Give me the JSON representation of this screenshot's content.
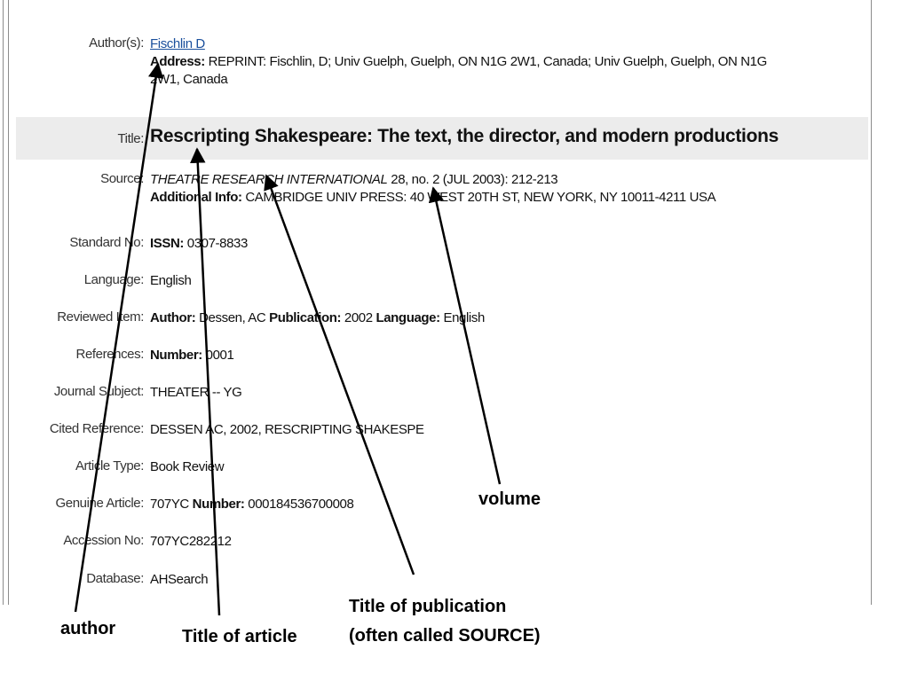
{
  "record": {
    "author": {
      "label": "Author(s):",
      "name": "Fischlin D",
      "address_label": "Address:",
      "address_line1": " REPRINT: Fischlin, D; Univ Guelph, Guelph, ON N1G 2W1, Canada; Univ Guelph, Guelph, ON N1G",
      "address_line2": "2W1, Canada"
    },
    "title": {
      "label": "Title:",
      "value": "Rescripting Shakespeare: The text, the director, and modern productions"
    },
    "source": {
      "label": "Source:",
      "journal": "THEATRE RESEARCH INTERNATIONAL",
      "detail": " 28, no. 2 (JUL 2003): 212-213",
      "additional_label": "Additional Info:",
      "additional_value": " CAMBRIDGE UNIV PRESS: 40 WEST 20TH ST, NEW YORK, NY 10011-4211 USA"
    },
    "standard_no": {
      "label": "Standard No:",
      "key": "ISSN:",
      "value": " 0307-8833"
    },
    "language": {
      "label": "Language:",
      "value": "English"
    },
    "reviewed_item": {
      "label": "Reviewed Item:",
      "author_label": "Author:",
      "author_value": " Dessen, AC ",
      "publication_label": "Publication:",
      "publication_value": " 2002 ",
      "language_label": "Language:",
      "language_value": " English"
    },
    "references": {
      "label": "References:",
      "key": "Number:",
      "value": " 0001"
    },
    "journal_subject": {
      "label": "Journal Subject:",
      "value": "THEATER -- YG"
    },
    "cited_reference": {
      "label": "Cited Reference:",
      "value": "DESSEN AC, 2002, RESCRIPTING SHAKESPE"
    },
    "article_type": {
      "label": "Article Type:",
      "value": "Book Review"
    },
    "genuine_article": {
      "label": "Genuine Article:",
      "pre": "707YC ",
      "key": "Number:",
      "value": " 000184536700008"
    },
    "accession_no": {
      "label": "Accession No:",
      "value": "707YC282212"
    },
    "database": {
      "label": "Database:",
      "value": "AHSearch"
    }
  },
  "callouts": {
    "author": "author",
    "title_of_article": "Title of article",
    "title_of_publication_line1": "Title of publication",
    "title_of_publication_line2": "(often called SOURCE)",
    "volume": "volume"
  },
  "colors": {
    "link": "#1a4f9c",
    "title_band": "#ececec",
    "label_text": "#333333",
    "frame_line": "#8c8c8c",
    "arrow": "#000000"
  }
}
